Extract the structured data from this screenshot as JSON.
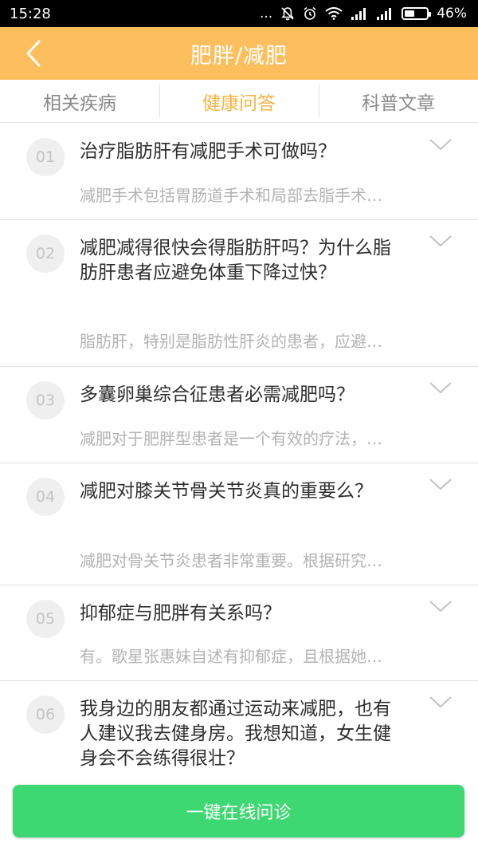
{
  "status_bar": {
    "time": "15:28",
    "dots": "...",
    "battery_pct": "46%",
    "battery_level": 0.46
  },
  "header": {
    "title": "肥胖/减肥",
    "back_icon": "chevron-left-icon"
  },
  "tabs": [
    {
      "label": "相关疾病",
      "active": false
    },
    {
      "label": "健康问答",
      "active": true
    },
    {
      "label": "科普文章",
      "active": false
    }
  ],
  "qa": [
    {
      "num": "01",
      "question": "治疗脂肪肝有减肥手术可做吗？",
      "answer": "减肥手术包括胃肠道手术和局部去脂手术…"
    },
    {
      "num": "02",
      "question": "减肥减得很快会得脂肪肝吗？为什么脂肪肝患者应避免体重下降过快？",
      "answer": "脂肪肝，特别是脂肪性肝炎的患者，应避…"
    },
    {
      "num": "03",
      "question": "多囊卵巢综合征患者必需减肥吗？",
      "answer": "减肥对于肥胖型患者是一个有效的疗法，…"
    },
    {
      "num": "04",
      "question": "减肥对膝关节骨关节炎真的重要么？",
      "answer": "减肥对骨关节炎患者非常重要。根据研究…"
    },
    {
      "num": "05",
      "question": "抑郁症与肥胖有关系吗？",
      "answer": "有。歌星张惠妹自述有抑郁症，且根据她…"
    },
    {
      "num": "06",
      "question": "我身边的朋友都通过运动来减肥，也有人建议我去健身房。我想知道，女生健身会不会练得很壮？",
      "answer": ""
    }
  ],
  "consult_button": {
    "label": "一键在线问诊"
  },
  "colors": {
    "header": "#fdbf5e",
    "active_tab": "#f5b546",
    "button": "#3dd872"
  }
}
